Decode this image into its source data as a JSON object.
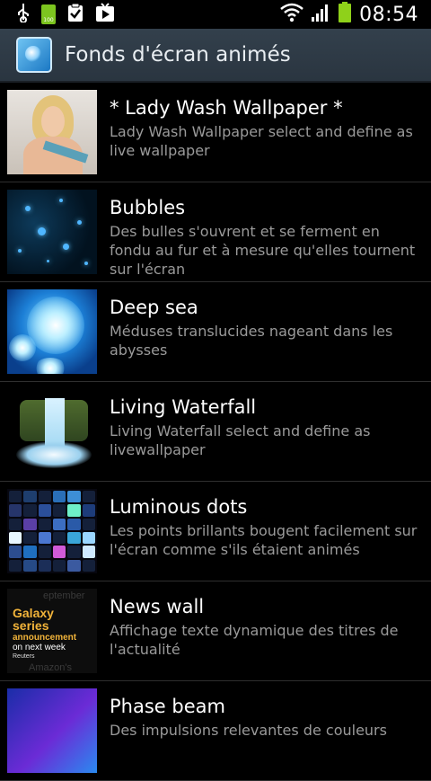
{
  "status_bar": {
    "time": "08:54",
    "icons": [
      "usb-icon",
      "battery-app-icon",
      "clipboard-check-icon",
      "play-store-icon",
      "wifi-icon",
      "signal-icon",
      "battery-icon"
    ],
    "battery_app_label": "100"
  },
  "action_bar": {
    "title": "Fonds d'écran animés",
    "icon": "live-wallpaper-icon"
  },
  "wallpapers": [
    {
      "title": "* Lady Wash Wallpaper *",
      "description": "Lady Wash Wallpaper select and define as live wallpaper"
    },
    {
      "title": "Bubbles",
      "description": "Des bulles s'ouvrent et se ferment en fondu au fur et à mesure qu'elles tournent sur l'écran"
    },
    {
      "title": "Deep sea",
      "description": "Méduses translucides nageant dans les abysses"
    },
    {
      "title": "Living Waterfall",
      "description": "Living Waterfall select and define as livewallpaper"
    },
    {
      "title": "Luminous dots",
      "description": "Les points brillants bougent facilement sur l'écran comme s'ils étaient animés"
    },
    {
      "title": "News wall",
      "description": "Affichage texte dynamique des titres de l'actualité"
    },
    {
      "title": "Phase beam",
      "description": "Des impulsions relevantes de couleurs"
    }
  ],
  "news_thumb": {
    "line1": "Galaxy",
    "line2": "series",
    "line3": "announcement",
    "line4": "on next week",
    "source": "Reuters"
  },
  "colors": {
    "action_bar": "#2f3b46",
    "description_text": "#9a9a9a",
    "battery": "#8fd11a"
  }
}
